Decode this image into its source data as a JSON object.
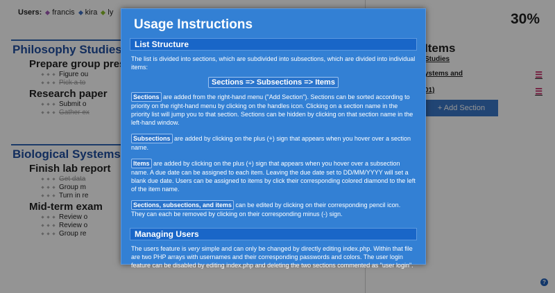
{
  "users": {
    "label": "Users:",
    "list": [
      {
        "name": "francis",
        "color": "#a35ab8"
      },
      {
        "name": "kira",
        "color": "#3d6fc2"
      },
      {
        "name": "ly",
        "color": "#8bbd2a"
      }
    ]
  },
  "progress": {
    "text": "30%",
    "value": 30
  },
  "sections": [
    {
      "title": "Philosophy Studies",
      "subsections": [
        {
          "title": "Prepare group pres",
          "items": [
            {
              "text": "Figure ou"
            },
            {
              "text": "Pick a to"
            }
          ]
        },
        {
          "title": "Research paper",
          "items": [
            {
              "text": "Submit o"
            },
            {
              "text": "Gather ex"
            }
          ]
        }
      ]
    },
    {
      "title": "Biological Systems",
      "subsections": [
        {
          "title": "Finish lab report",
          "items": [
            {
              "text": "Get data"
            },
            {
              "text": "Group m"
            },
            {
              "text": "Turn in re"
            }
          ]
        },
        {
          "title": "Mid-term exam",
          "items": [
            {
              "text": "Review o"
            },
            {
              "text": "Review o"
            },
            {
              "text": "Group re"
            }
          ]
        }
      ]
    }
  ],
  "priority": {
    "title": "Items",
    "items": [
      {
        "label": "Studies"
      },
      {
        "label": "ystems and"
      },
      {
        "label": "01)"
      }
    ],
    "add_button": "+ Add Section"
  },
  "help_label": "?",
  "modal": {
    "title": "Usage Instructions",
    "list_structure": {
      "heading": "List Structure",
      "intro": "The list is divided into sections, which are subdivided into subsections, which are divided into individual items:",
      "flow": "Sections => Subsections => Items",
      "sections_tag": "Sections",
      "sections_text": " are added from the right-hand menu (\"Add Section\"). Sections can be sorted according to priority on the right-hand menu by clicking on the handles icon. Clicking on a section name in the priority list will jump you to that section. Sections can be hidden by clicking on that section name in the left-hand window.",
      "subsections_tag": "Subsections",
      "subsections_text": " are added by clicking on the plus (+) sign that appears when you hover over a section name.",
      "items_tag": "Items",
      "items_text": " are added by clicking on the plus (+) sign that appears when you hover over a subsection name. A due date can be assigned to each item. Leaving the due date set to DD/MM/YYYY will set a blank due date. Users can be assigned to items by click their corresponding colored diamond to the left of the item name.",
      "all_tag": "Sections, subsections, and items",
      "all_text": " can be edited by clicking on their corresponding pencil icon. They can each be removed by clicking on their corresponding minus (-) sign."
    },
    "managing_users": {
      "heading": "Managing Users",
      "text_before": "The users feature is ",
      "emph": "very",
      "text_after": " simple and can only be changed by directly editing index.php. Within that file are two PHP arrays with usernames and their corresponding passwords and colors. The user login feature can be disabled by editing index.php and deleting the two sections commented as \"user login\"."
    }
  }
}
